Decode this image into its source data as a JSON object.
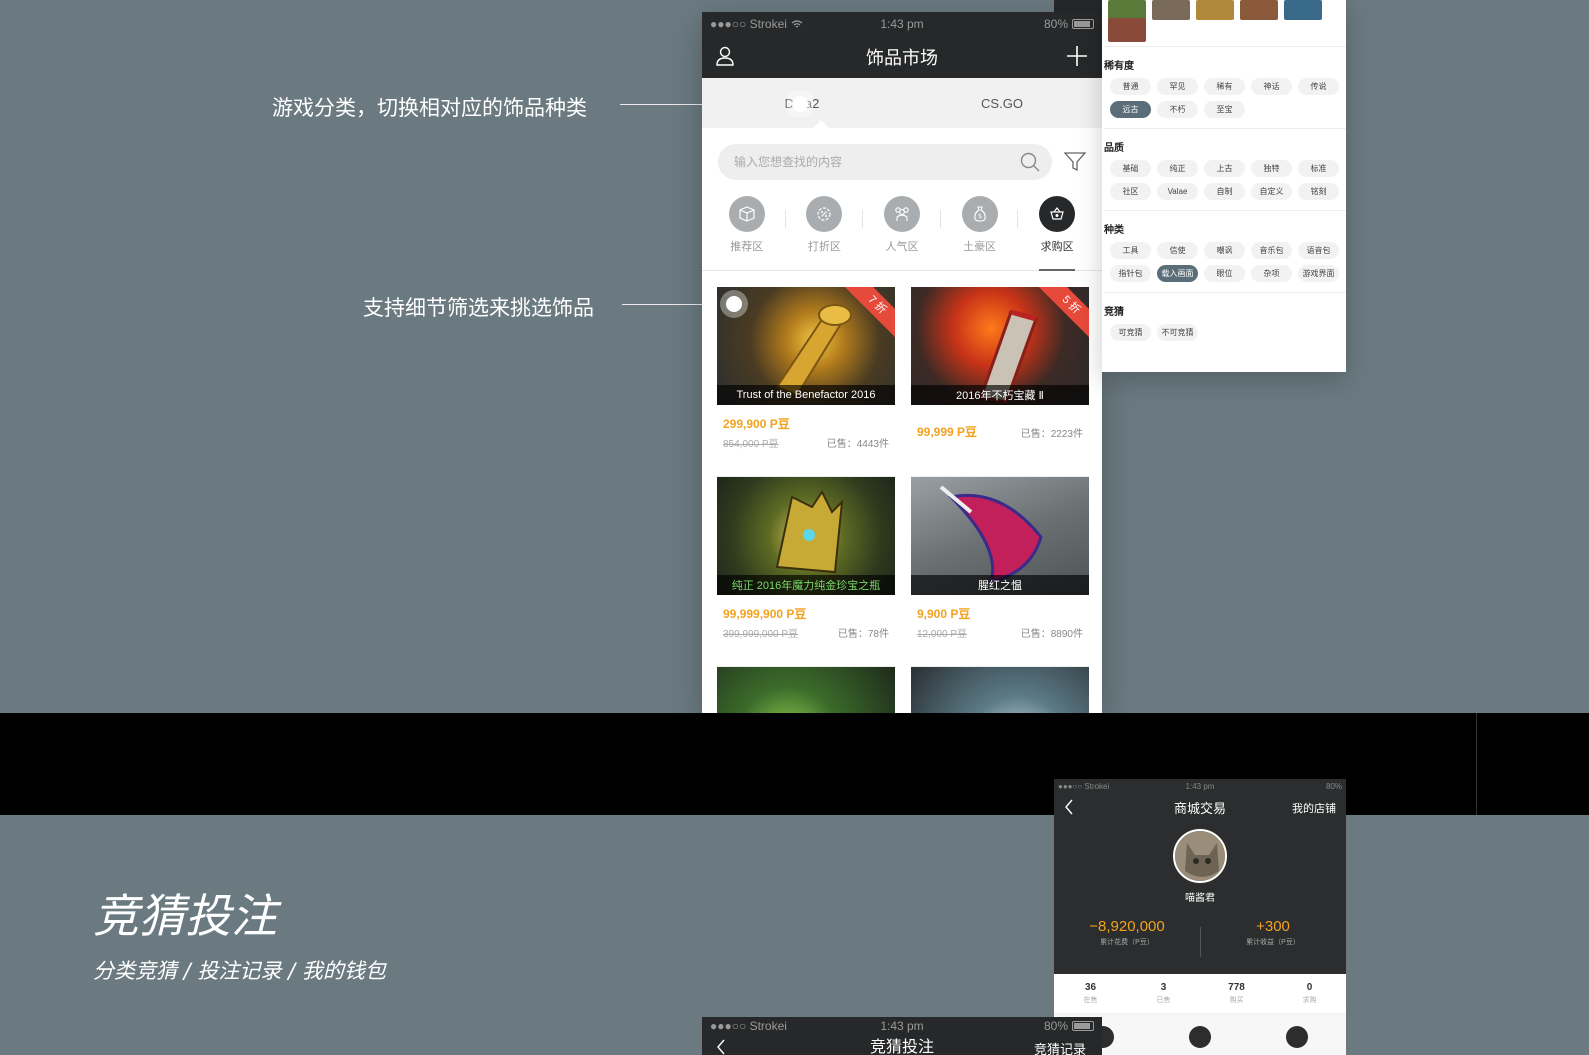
{
  "annotations": {
    "game_category": "游戏分类，切换相对应的饰品种类",
    "detail_filter": "支持细节筛选来挑选饰品"
  },
  "phone1": {
    "status": {
      "carrier": "●●●○○ Strokei",
      "time": "1:43 pm",
      "battery": "80%"
    },
    "title": "饰品市场",
    "tabs": [
      "Dota2",
      "CS.GO"
    ],
    "search_placeholder": "输入您想查找的内容",
    "categories": [
      {
        "label": "推荐区",
        "icon": "box-icon"
      },
      {
        "label": "打折区",
        "icon": "discount-gear-icon"
      },
      {
        "label": "人气区",
        "icon": "people-icon"
      },
      {
        "label": "土豪区",
        "icon": "money-bag-icon"
      },
      {
        "label": "求购区",
        "icon": "shopping-basket-icon"
      }
    ],
    "items": [
      {
        "name": "Trust of the Benefactor 2016",
        "price": "299,900 P豆",
        "original": "854,000 P豆",
        "sold": "已售：4443件",
        "badge": "7 折",
        "theme": "gold"
      },
      {
        "name": "2016年不朽宝藏 Ⅱ",
        "price": "99,999 P豆",
        "original": "",
        "sold": "已售：2223件",
        "badge": "5 折",
        "theme": "red"
      },
      {
        "name": "纯正 2016年魔力纯金珍宝之瓶",
        "price": "99,999,900 P豆",
        "original": "399,999,000 P豆",
        "sold": "已售：78件",
        "badge": "",
        "theme": "green"
      },
      {
        "name": "腥红之愠",
        "price": "9,900 P豆",
        "original": "12,000 P豆",
        "sold": "已售：8890件",
        "badge": "",
        "theme": "gray"
      }
    ]
  },
  "filter_panel": {
    "sections": [
      {
        "title": "稀有度",
        "options": [
          "普通",
          "罕见",
          "稀有",
          "神话",
          "传说",
          "远古",
          "不朽",
          "至宝"
        ],
        "selected": "远古"
      },
      {
        "title": "品质",
        "options": [
          "基础",
          "纯正",
          "上古",
          "独特",
          "标准",
          "社区",
          "Valae",
          "自制",
          "自定义",
          "铭刻"
        ],
        "selected": ""
      },
      {
        "title": "种类",
        "options": [
          "工具",
          "信使",
          "嘲讽",
          "音乐包",
          "语音包",
          "指针包",
          "载入画面",
          "眼位",
          "杂项",
          "游戏界面"
        ],
        "selected": "载入画面"
      },
      {
        "title": "竞猜",
        "options": [
          "可竞猜",
          "不可竞猜"
        ],
        "selected": ""
      }
    ]
  },
  "section": {
    "title": "竞猜投注",
    "subtitle": "分类竞猜  /  投注记录  /  我的钱包"
  },
  "phone2": {
    "status": {
      "carrier": "●●●○○ Strokei",
      "time": "1:43 pm",
      "battery": "80%"
    },
    "title": "商城交易",
    "shop_link": "我的店铺",
    "username": "喵酱君",
    "stats": [
      {
        "value": "−8,920,000",
        "label": "累计花费（P豆）"
      },
      {
        "value": "+300",
        "label": "累计收益（P豆）"
      }
    ],
    "counts": [
      {
        "value": "36",
        "label": "在售"
      },
      {
        "value": "3",
        "label": "已售"
      },
      {
        "value": "778",
        "label": "购买"
      },
      {
        "value": "0",
        "label": "求购"
      }
    ]
  },
  "phone3": {
    "status": {
      "carrier": "●●●○○ Strokei",
      "time": "1:43 pm",
      "battery": "80%"
    },
    "title": "竞猜投注",
    "right": "竞猜记录"
  },
  "colors": {
    "accent_price": "#f2a21f",
    "nav_dark": "#262829",
    "selected_chip": "#5b6d78",
    "discount_ribbon": "#e64a3b"
  }
}
